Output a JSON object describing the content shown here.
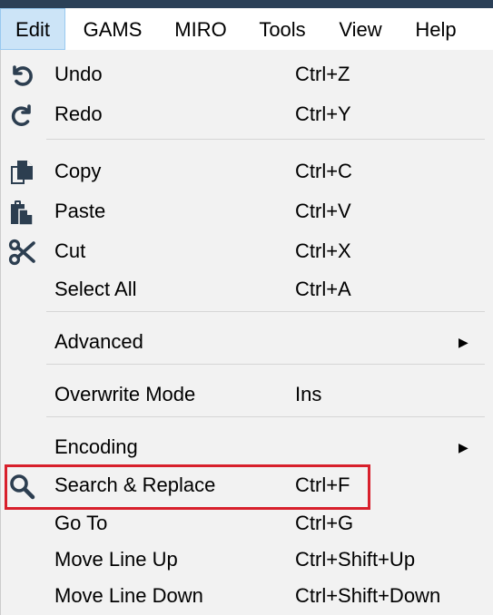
{
  "menubar": {
    "items": [
      {
        "label": "Edit"
      },
      {
        "label": "GAMS"
      },
      {
        "label": "MIRO"
      },
      {
        "label": "Tools"
      },
      {
        "label": "View"
      },
      {
        "label": "Help"
      }
    ]
  },
  "edit_menu": {
    "undo": {
      "label": "Undo",
      "shortcut": "Ctrl+Z",
      "icon": "undo-icon"
    },
    "redo": {
      "label": "Redo",
      "shortcut": "Ctrl+Y",
      "icon": "redo-icon"
    },
    "copy": {
      "label": "Copy",
      "shortcut": "Ctrl+C",
      "icon": "copy-icon"
    },
    "paste": {
      "label": "Paste",
      "shortcut": "Ctrl+V",
      "icon": "paste-icon"
    },
    "cut": {
      "label": "Cut",
      "shortcut": "Ctrl+X",
      "icon": "scissors-icon"
    },
    "select_all": {
      "label": "Select All",
      "shortcut": "Ctrl+A"
    },
    "advanced": {
      "label": "Advanced"
    },
    "overwrite_mode": {
      "label": "Overwrite Mode",
      "shortcut": "Ins"
    },
    "encoding": {
      "label": "Encoding"
    },
    "search_replace": {
      "label": "Search & Replace",
      "shortcut": "Ctrl+F",
      "icon": "search-icon"
    },
    "go_to": {
      "label": "Go To",
      "shortcut": "Ctrl+G"
    },
    "move_line_up": {
      "label": "Move Line Up",
      "shortcut": "Ctrl+Shift+Up"
    },
    "move_line_down": {
      "label": "Move Line Down",
      "shortcut": "Ctrl+Shift+Down"
    }
  },
  "colors": {
    "highlight_box": "#d8202c",
    "active_menu_bg": "#cce4f7",
    "icon": "#2c3e50",
    "top_strip": "#2b4057"
  }
}
